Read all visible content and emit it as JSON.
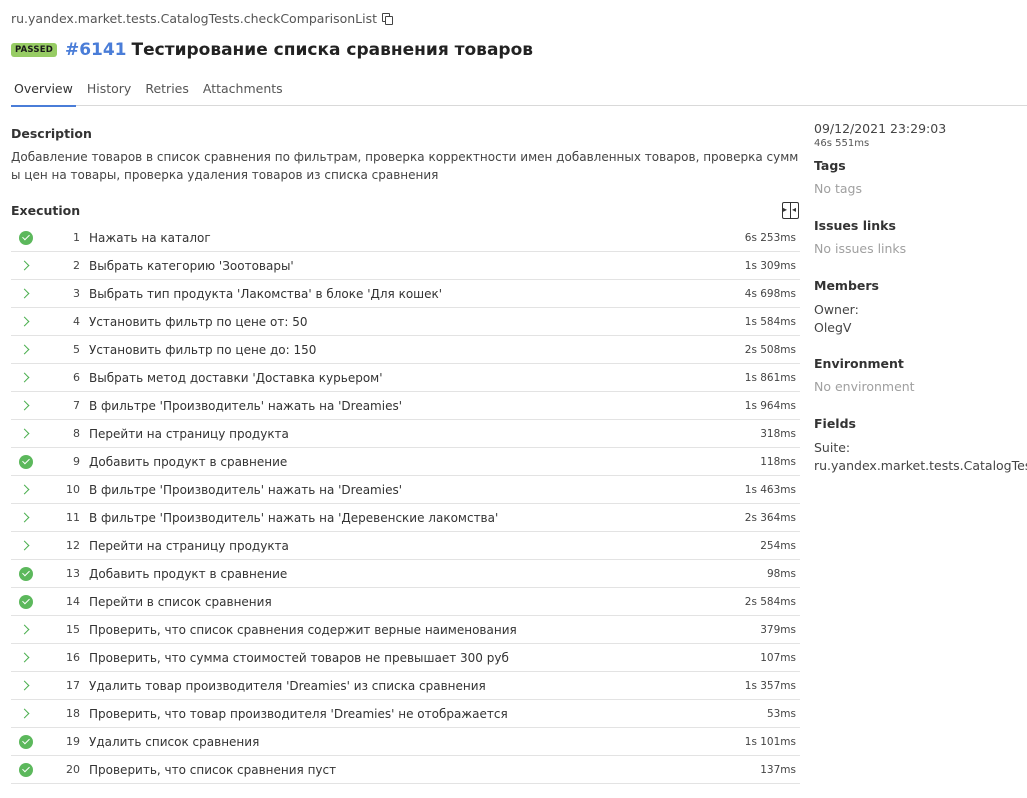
{
  "header": {
    "full_name": "ru.yandex.market.tests.CatalogTests.checkComparisonList",
    "status_badge": "PASSED",
    "test_number": "#6141",
    "test_title": "Тестирование списка сравнения товаров"
  },
  "tabs": [
    {
      "label": "Overview",
      "active": true
    },
    {
      "label": "History",
      "active": false
    },
    {
      "label": "Retries",
      "active": false
    },
    {
      "label": "Attachments",
      "active": false
    }
  ],
  "description": {
    "heading": "Description",
    "text": "Добавление товаров в список сравнения по фильтрам, проверка корректности имен добавленных товаров, проверка суммы цен на товары, проверка удаления товаров из списка сравнения"
  },
  "execution": {
    "heading": "Execution",
    "steps": [
      {
        "num": "1",
        "name": "Нажать на каталог",
        "duration": "6s 253ms",
        "icon": "check-circle-icon"
      },
      {
        "num": "2",
        "name": "Выбрать категорию 'Зоотовары'",
        "duration": "1s 309ms",
        "icon": "chevron-right-icon"
      },
      {
        "num": "3",
        "name": "Выбрать тип продукта 'Лакомства' в блоке 'Для кошек'",
        "duration": "4s 698ms",
        "icon": "chevron-right-icon"
      },
      {
        "num": "4",
        "name": "Установить фильтр по цене от: 50",
        "duration": "1s 584ms",
        "icon": "chevron-right-icon"
      },
      {
        "num": "5",
        "name": "Установить фильтр по цене до: 150",
        "duration": "2s 508ms",
        "icon": "chevron-right-icon"
      },
      {
        "num": "6",
        "name": "Выбрать метод доставки 'Доставка курьером'",
        "duration": "1s 861ms",
        "icon": "chevron-right-icon"
      },
      {
        "num": "7",
        "name": "В фильтре 'Производитель' нажать на 'Dreamies'",
        "duration": "1s 964ms",
        "icon": "chevron-right-icon"
      },
      {
        "num": "8",
        "name": "Перейти на страницу продукта",
        "duration": "318ms",
        "icon": "chevron-right-icon"
      },
      {
        "num": "9",
        "name": "Добавить продукт в сравнение",
        "duration": "118ms",
        "icon": "check-circle-icon"
      },
      {
        "num": "10",
        "name": "В фильтре 'Производитель' нажать на 'Dreamies'",
        "duration": "1s 463ms",
        "icon": "chevron-right-icon"
      },
      {
        "num": "11",
        "name": "В фильтре 'Производитель' нажать на 'Деревенские лакомства'",
        "duration": "2s 364ms",
        "icon": "chevron-right-icon"
      },
      {
        "num": "12",
        "name": "Перейти на страницу продукта",
        "duration": "254ms",
        "icon": "chevron-right-icon"
      },
      {
        "num": "13",
        "name": "Добавить продукт в сравнение",
        "duration": "98ms",
        "icon": "check-circle-icon"
      },
      {
        "num": "14",
        "name": "Перейти в список сравнения",
        "duration": "2s 584ms",
        "icon": "check-circle-icon"
      },
      {
        "num": "15",
        "name": "Проверить, что список сравнения содержит верные наименования",
        "duration": "379ms",
        "icon": "chevron-right-icon"
      },
      {
        "num": "16",
        "name": "Проверить, что сумма стоимостей товаров не превышает 300 руб",
        "duration": "107ms",
        "icon": "chevron-right-icon"
      },
      {
        "num": "17",
        "name": "Удалить товар производителя 'Dreamies' из списка сравнения",
        "duration": "1s 357ms",
        "icon": "chevron-right-icon"
      },
      {
        "num": "18",
        "name": "Проверить, что товар производителя 'Dreamies' не отображается",
        "duration": "53ms",
        "icon": "chevron-right-icon"
      },
      {
        "num": "19",
        "name": "Удалить список сравнения",
        "duration": "1s 101ms",
        "icon": "check-circle-icon"
      },
      {
        "num": "20",
        "name": "Проверить, что список сравнения пуст",
        "duration": "137ms",
        "icon": "check-circle-icon"
      }
    ]
  },
  "sidebar": {
    "date": "09/12/2021 23:29:03",
    "duration": "46s 551ms",
    "tags_heading": "Tags",
    "tags_empty": "No tags",
    "issues_heading": "Issues links",
    "issues_empty": "No issues links",
    "members_heading": "Members",
    "owner_label": "Owner:",
    "owner_value": "OlegV",
    "environment_heading": "Environment",
    "environment_empty": "No environment",
    "fields_heading": "Fields",
    "suite_label": "Suite:",
    "suite_value": "ru.yandex.market.tests.CatalogTests"
  },
  "colors": {
    "accent": "#4a7dd8",
    "passed_badge": "#97cc64",
    "success": "#5cb85c"
  }
}
